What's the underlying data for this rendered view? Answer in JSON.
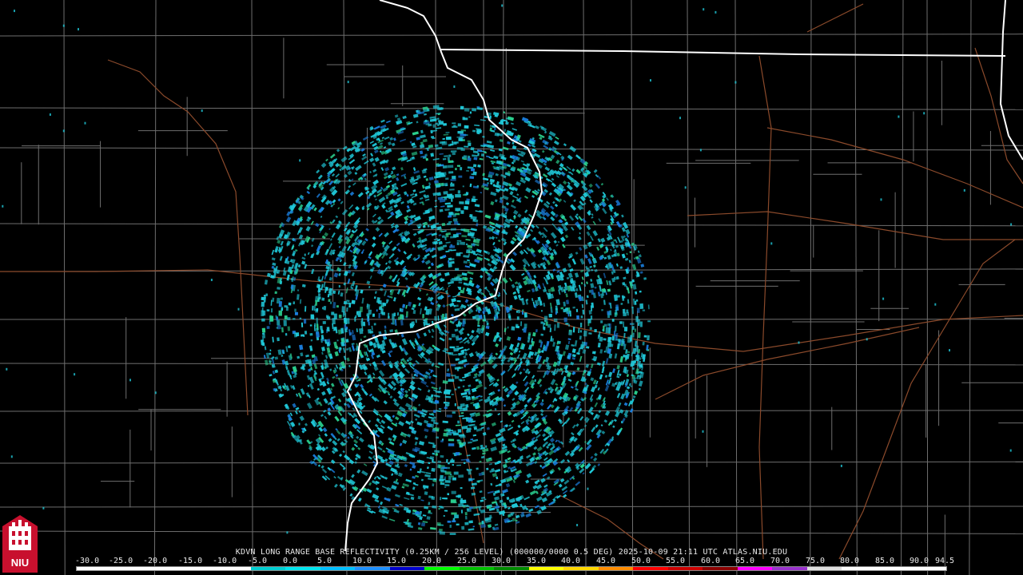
{
  "caption": {
    "station_line": "KDVN LONG RANGE BASE REFLECTIVITY (0.25KM / 256 LEVEL) (000000/0000 0.5 DEG) 2025-10-09 21:11 UTC  ATLAS.NIU.EDU"
  },
  "logo": {
    "text": "NIU",
    "color": "#c8102e"
  },
  "colorscale": {
    "labels": [
      "-30.0",
      "-25.0",
      "-20.0",
      "-15.0",
      "-10.0",
      "-5.0",
      "0.0",
      "5.0",
      "10.0",
      "15.0",
      "20.0",
      "25.0",
      "30.0",
      "35.0",
      "40.0",
      "45.0",
      "50.0",
      "55.0",
      "60.0",
      "65.0",
      "70.0",
      "75.0",
      "80.0",
      "85.0",
      "90.0",
      "94.5"
    ],
    "colors": [
      "#ffffff",
      "#ffffff",
      "#ffffff",
      "#ffffff",
      "#ffffff",
      "#00ced1",
      "#00e5ee",
      "#00bfff",
      "#1e90ff",
      "#0000cd",
      "#00ff00",
      "#00c000",
      "#008b00",
      "#ffff00",
      "#ffd700",
      "#ff8c00",
      "#ff0000",
      "#cd0000",
      "#8b0000",
      "#ff00ff",
      "#9932cc",
      "#e0e0e0",
      "#ffffff",
      "#ffffff",
      "#ffffff"
    ]
  },
  "map": {
    "radar_site": "KDVN",
    "colors": {
      "county_lines": "#6e6e6e",
      "state_lines": "#ffffff",
      "highways": "#8b4a2b",
      "echo_primary": "#1fc8d8",
      "echo_secondary": "#1a7fe0",
      "echo_tertiary": "#2ad18f"
    }
  }
}
